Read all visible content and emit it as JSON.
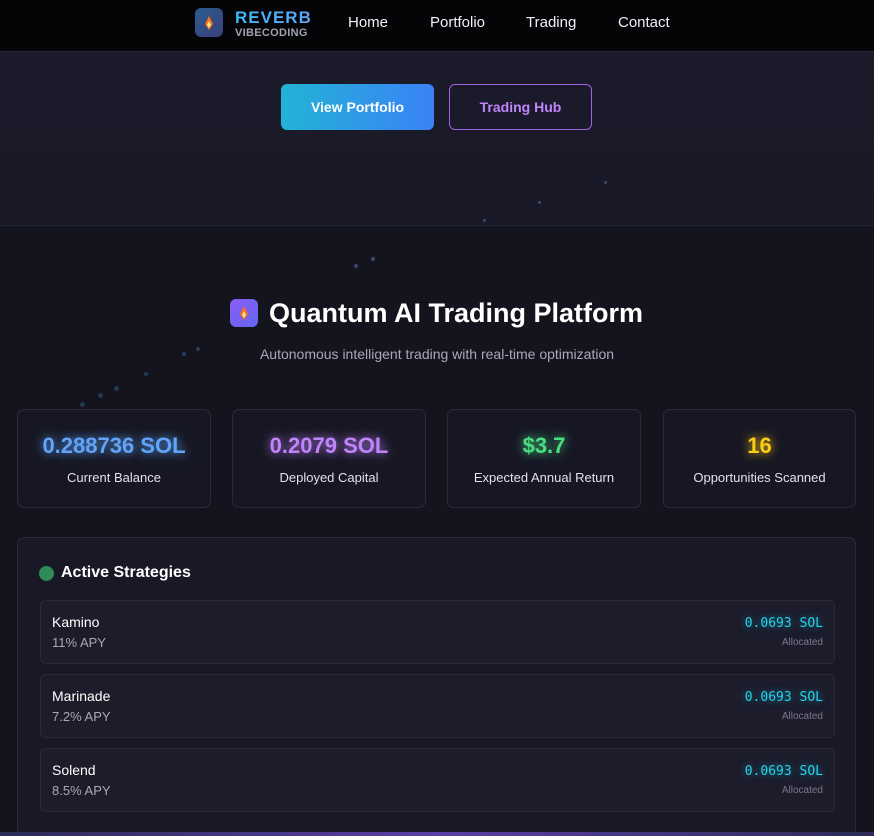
{
  "navbar": {
    "brand": "REVERB",
    "brand_sub": "VIBECODING",
    "links": [
      "Home",
      "Portfolio",
      "Trading",
      "Contact"
    ]
  },
  "hero": {
    "primary_button": "View Portfolio",
    "secondary_button": "Trading Hub"
  },
  "platform": {
    "title": "Quantum AI Trading Platform",
    "subtitle": "Autonomous intelligent trading with real-time optimization"
  },
  "stats": [
    {
      "value": "0.288736 SOL",
      "label": "Current Balance",
      "color": "#60a5fa"
    },
    {
      "value": "0.2079 SOL",
      "label": "Deployed Capital",
      "color": "#c084fc"
    },
    {
      "value": "$3.7",
      "label": "Expected Annual Return",
      "color": "#4ade80"
    },
    {
      "value": "16",
      "label": "Opportunities Scanned",
      "color": "#facc15"
    }
  ],
  "strategies": {
    "title": "Active Strategies",
    "items": [
      {
        "name": "Kamino",
        "apy": "11% APY",
        "amount": "0.0693 SOL",
        "status": "Allocated"
      },
      {
        "name": "Marinade",
        "apy": "7.2% APY",
        "amount": "0.0693 SOL",
        "status": "Allocated"
      },
      {
        "name": "Solend",
        "apy": "8.5% APY",
        "amount": "0.0693 SOL",
        "status": "Allocated"
      }
    ]
  },
  "colors": {
    "accent_blue": "#3b82f6",
    "accent_cyan": "#22d3ee",
    "accent_purple": "#a064e0",
    "background": "#14141f"
  }
}
